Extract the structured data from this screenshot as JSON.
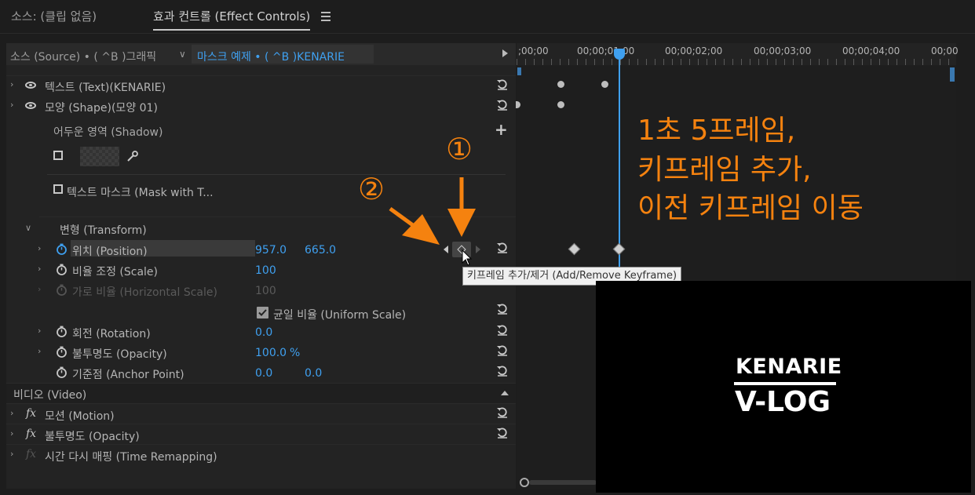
{
  "tabs": {
    "source": "소스: (클립 없음)",
    "effect_controls": "효과 컨트롤 (Effect Controls)",
    "menu_icon": "hamburger-menu-icon"
  },
  "header": {
    "source_clip": "소스 (Source) • ( ^B )그래픽",
    "sequence_clip": "마스크 예제 • ( ^B )KENARIE"
  },
  "timeline": {
    "ruler": [
      ";00;00",
      "00;00;01;00",
      "00;00;02;00",
      "00;00;03;00",
      "00;00;04;00",
      "00;00"
    ]
  },
  "layers": {
    "text": "텍스트 (Text)(KENARIE)",
    "shape": "모양 (Shape)(모양 01)",
    "shadow": "어두운 영역 (Shadow)",
    "text_mask": "텍스트 마스크 (Mask with T..."
  },
  "transform": {
    "title": "변형 (Transform)",
    "position": {
      "label": "위치 (Position)",
      "x": "957.0",
      "y": "665.0"
    },
    "scale": {
      "label": "비율 조정 (Scale)",
      "value": "100"
    },
    "horizontal_scale": {
      "label": "가로 비율 (Horizontal Scale)",
      "value": "100"
    },
    "uniform_scale": "균일 비율 (Uniform Scale)",
    "rotation": {
      "label": "회전 (Rotation)",
      "value": "0.0"
    },
    "opacity": {
      "label": "불투명도 (Opacity)",
      "value": "100.0",
      "unit": "%"
    },
    "anchor": {
      "label": "기준점 (Anchor Point)",
      "x": "0.0",
      "y": "0.0"
    }
  },
  "video": {
    "title": "비디오 (Video)",
    "motion": "모션 (Motion)",
    "opacity": "불투명도 (Opacity)",
    "time_remap": "시간 다시 매핑 (Time Remapping)",
    "fx_icon": "fx"
  },
  "tooltip": "키프레임 추가/제거 (Add/Remove Keyframe)",
  "annotation": {
    "line1": "1초 5프레임,",
    "line2": "키프레임 추가,",
    "line3": "이전 키프레임 이동",
    "marker1": "①",
    "marker2": "②",
    "color": "#f5820f"
  },
  "preview": {
    "line1": "KENARIE",
    "line2": "V-LOG"
  }
}
